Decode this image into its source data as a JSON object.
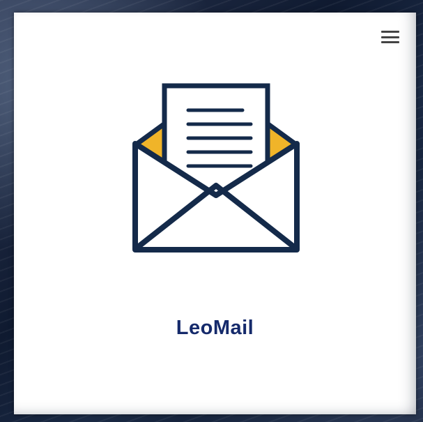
{
  "app": {
    "label": "LeoMail",
    "icon": "envelope-letter-icon"
  },
  "menu": {
    "icon": "hamburger-menu-icon"
  },
  "colors": {
    "label": "#152a6b",
    "icon_outline": "#142a4a",
    "icon_accent": "#f0b429",
    "tile_background": "#ffffff"
  }
}
